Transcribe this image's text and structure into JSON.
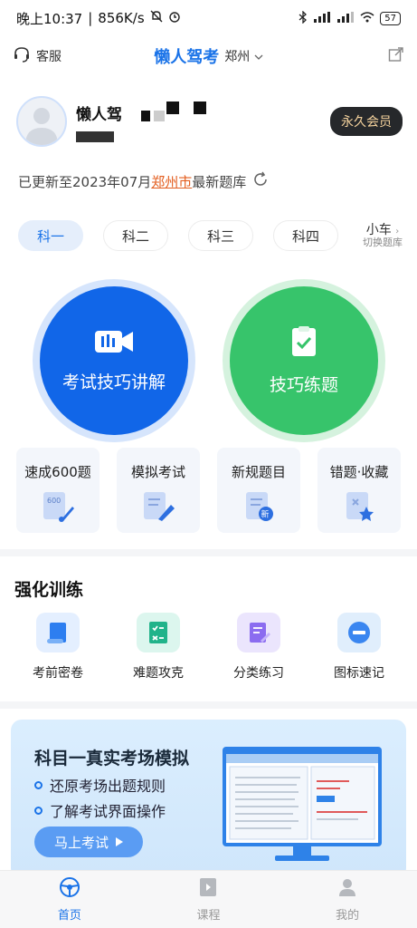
{
  "status_bar": {
    "time": "晚上10:37",
    "speed": "856K/s",
    "battery": "57"
  },
  "header": {
    "service_label": "客服",
    "app_title": "懒人驾考",
    "city": "郑州"
  },
  "profile": {
    "name": "懒人驾",
    "vip_label": "永久会员"
  },
  "update_notice": {
    "prefix": "已更新至2023年07月",
    "city": "郑州市",
    "suffix": "最新题库"
  },
  "subject_tabs": [
    {
      "label": "科一",
      "active": true
    },
    {
      "label": "科二",
      "active": false
    },
    {
      "label": "科三",
      "active": false
    },
    {
      "label": "科四",
      "active": false
    }
  ],
  "car_switch": {
    "title": "小车",
    "subtitle": "切换题库"
  },
  "main_buttons": {
    "tips_lecture": "考试技巧讲解",
    "tips_practice": "技巧练题"
  },
  "quick_entries": [
    {
      "label": "速成600题",
      "icon": "rocket-book-icon"
    },
    {
      "label": "模拟考试",
      "icon": "exam-pen-icon"
    },
    {
      "label": "新规题目",
      "icon": "new-doc-icon"
    },
    {
      "label": "错题·收藏",
      "icon": "wrong-star-icon"
    }
  ],
  "training": {
    "title": "强化训练",
    "items": [
      {
        "label": "考前密卷",
        "icon": "scroll-icon"
      },
      {
        "label": "难题攻克",
        "icon": "checklist-icon"
      },
      {
        "label": "分类练习",
        "icon": "edit-doc-icon"
      },
      {
        "label": "图标速记",
        "icon": "minus-circle-icon"
      }
    ]
  },
  "banner": {
    "title": "科目一真实考场模拟",
    "point1": "还原考场出题规则",
    "point2": "了解考试界面操作",
    "button": "马上考试"
  },
  "tabbar": [
    {
      "label": "首页",
      "active": true
    },
    {
      "label": "课程",
      "active": false
    },
    {
      "label": "我的",
      "active": false
    }
  ],
  "colors": {
    "primary": "#1a73e8",
    "green": "#37c46b",
    "accent_orange": "#e35d1e",
    "vip_gold": "#f7d49e"
  }
}
